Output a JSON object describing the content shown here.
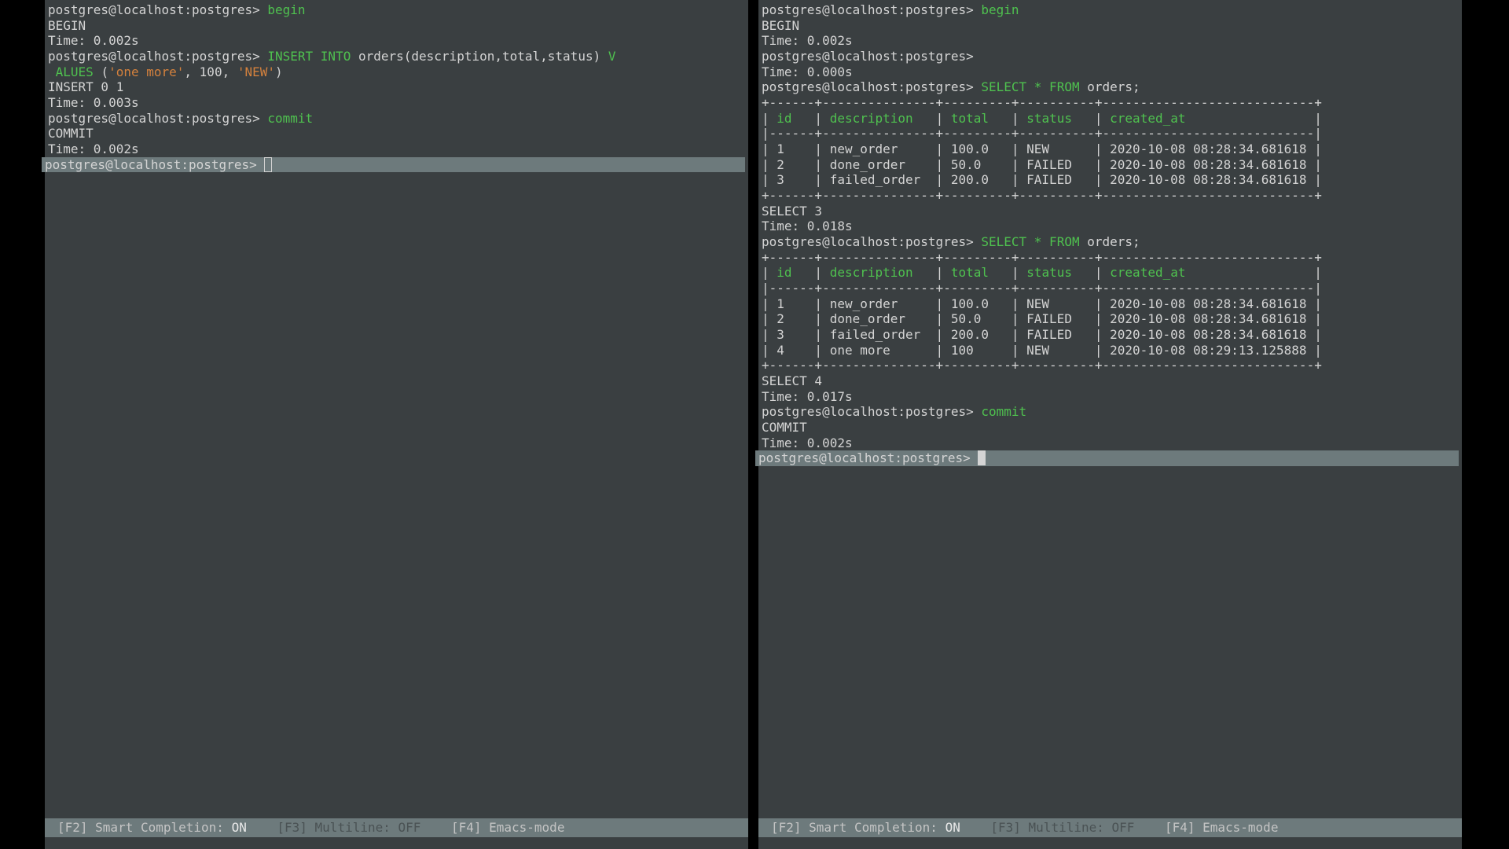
{
  "prompt": "postgres@localhost:postgres> ",
  "left": {
    "lines": [
      {
        "segments": [
          {
            "cls": "prompt",
            "t": "prompt"
          },
          {
            "cls": "kw-green",
            "t": "begin"
          }
        ]
      },
      {
        "segments": [
          {
            "cls": "text-gray",
            "t": "BEGIN"
          }
        ]
      },
      {
        "segments": [
          {
            "cls": "text-gray",
            "t": "time002"
          }
        ]
      },
      {
        "segments": [
          {
            "cls": "prompt",
            "t": "prompt"
          },
          {
            "cls": "kw-green",
            "t": "insert_into"
          },
          {
            "cls": "text-gray",
            "t": " orders(description,total,status) "
          },
          {
            "cls": "kw-green",
            "t": "V"
          }
        ]
      },
      {
        "segments": [
          {
            "cls": "kw-green",
            "t": " ALUES "
          },
          {
            "cls": "text-gray",
            "t": "("
          },
          {
            "cls": "kw-orange",
            "t": "str_onemore"
          },
          {
            "cls": "text-gray",
            "t": ", 100, "
          },
          {
            "cls": "kw-orange",
            "t": "str_new"
          },
          {
            "cls": "text-gray",
            "t": ")"
          }
        ]
      },
      {
        "segments": [
          {
            "cls": "text-gray",
            "t": "insert01"
          }
        ]
      },
      {
        "segments": [
          {
            "cls": "text-gray",
            "t": "time003"
          }
        ]
      },
      {
        "segments": [
          {
            "cls": "prompt",
            "t": "prompt"
          },
          {
            "cls": "kw-green",
            "t": "commit"
          }
        ]
      },
      {
        "segments": [
          {
            "cls": "text-gray",
            "t": "COMMIT"
          }
        ]
      },
      {
        "segments": [
          {
            "cls": "text-gray",
            "t": "time002"
          }
        ]
      }
    ],
    "active_prompt": true
  },
  "right": {
    "lines": [
      {
        "segments": [
          {
            "cls": "prompt",
            "t": "prompt"
          },
          {
            "cls": "kw-green",
            "t": "begin"
          }
        ]
      },
      {
        "segments": [
          {
            "cls": "text-gray",
            "t": "BEGIN"
          }
        ]
      },
      {
        "segments": [
          {
            "cls": "text-gray",
            "t": "time002"
          }
        ]
      },
      {
        "segments": [
          {
            "cls": "prompt",
            "t": "prompt"
          }
        ]
      },
      {
        "segments": [
          {
            "cls": "text-gray",
            "t": "empty"
          }
        ]
      },
      {
        "segments": [
          {
            "cls": "text-gray",
            "t": "time000"
          }
        ]
      },
      {
        "segments": [
          {
            "cls": "prompt",
            "t": "prompt"
          },
          {
            "cls": "kw-green",
            "t": "select_star_from"
          },
          {
            "cls": "text-gray",
            "t": " orders;"
          }
        ]
      }
    ],
    "table1": {
      "border_top": "+------+---------------+---------+----------+----------------------------+",
      "header": "| id   | description   | total   | status   | created_at                 |",
      "border_mid": "|------+---------------+---------+----------+----------------------------|",
      "rows": [
        "| 1    | new_order     | 100.0   | NEW      | 2020-10-08 08:28:34.681618 |",
        "| 2    | done_order    | 50.0    | FAILED   | 2020-10-08 08:28:34.681618 |",
        "| 3    | failed_order  | 200.0   | FAILED   | 2020-10-08 08:28:34.681618 |"
      ],
      "border_bot": "+------+---------------+---------+----------+----------------------------+",
      "result": "SELECT 3",
      "time": "Time: 0.018s"
    },
    "lines2": [
      {
        "segments": [
          {
            "cls": "prompt",
            "t": "prompt"
          },
          {
            "cls": "kw-green",
            "t": "select_star_from"
          },
          {
            "cls": "text-gray",
            "t": " orders;"
          }
        ]
      }
    ],
    "table2": {
      "border_top": "+------+---------------+---------+----------+----------------------------+",
      "header": "| id   | description   | total   | status   | created_at                 |",
      "border_mid": "|------+---------------+---------+----------+----------------------------|",
      "rows": [
        "| 1    | new_order     | 100.0   | NEW      | 2020-10-08 08:28:34.681618 |",
        "| 2    | done_order    | 50.0    | FAILED   | 2020-10-08 08:28:34.681618 |",
        "| 3    | failed_order  | 200.0   | FAILED   | 2020-10-08 08:28:34.681618 |",
        "| 4    | one more      | 100     | NEW      | 2020-10-08 08:29:13.125888 |"
      ],
      "border_bot": "+------+---------------+---------+----------+----------------------------+",
      "result": "SELECT 4",
      "time": "Time: 0.017s"
    },
    "lines3": [
      {
        "segments": [
          {
            "cls": "prompt",
            "t": "prompt"
          },
          {
            "cls": "kw-green",
            "t": "commit"
          }
        ]
      },
      {
        "segments": [
          {
            "cls": "text-gray",
            "t": "COMMIT"
          }
        ]
      },
      {
        "segments": [
          {
            "cls": "text-gray",
            "t": "time002"
          }
        ]
      }
    ]
  },
  "literals": {
    "prompt": "postgres@localhost:postgres> ",
    "begin": "begin",
    "BEGIN": "BEGIN",
    "time002": "Time: 0.002s",
    "time003": "Time: 0.003s",
    "time000": "Time: 0.000s",
    "insert_into": "INSERT INTO",
    "V": "V",
    "str_onemore": "'one more'",
    "str_new": "'NEW'",
    "insert01": "INSERT 0 1",
    "commit": "commit",
    "COMMIT": "COMMIT",
    "select_star_from": "SELECT * FROM",
    "empty": ""
  },
  "headers_green": [
    "id",
    "description",
    "total",
    "status",
    "created_at"
  ],
  "status": {
    "f2_key": "[F2]",
    "f2_label": " Smart Completion: ",
    "f2_val": "ON",
    "f3_key": "[F3]",
    "f3_label": " Multiline: ",
    "f3_val": "OFF",
    "f4_key": "[F4]",
    "f4_label": " Emacs-mode"
  }
}
